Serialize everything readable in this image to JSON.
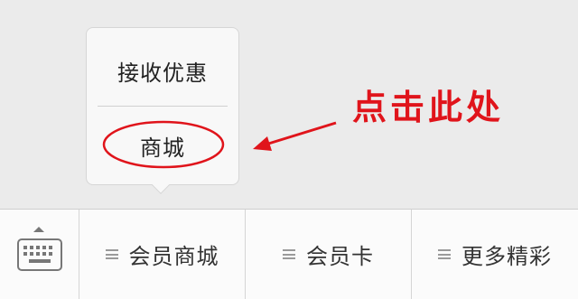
{
  "popup_menu": {
    "items": [
      {
        "label": "接收优惠"
      },
      {
        "label": "商城"
      }
    ]
  },
  "annotation": {
    "text": "点击此处",
    "color": "#e0141b"
  },
  "menu_bar": {
    "keyboard_icon": "keyboard-icon",
    "items": [
      {
        "label": "会员商城",
        "icon": "menu-lines-icon"
      },
      {
        "label": "会员卡",
        "icon": "menu-lines-icon"
      },
      {
        "label": "更多精彩",
        "icon": "menu-lines-icon"
      }
    ]
  },
  "colors": {
    "background": "#ebebeb",
    "menu_bar": "#fbfbfb",
    "highlight": "#e0141b"
  }
}
